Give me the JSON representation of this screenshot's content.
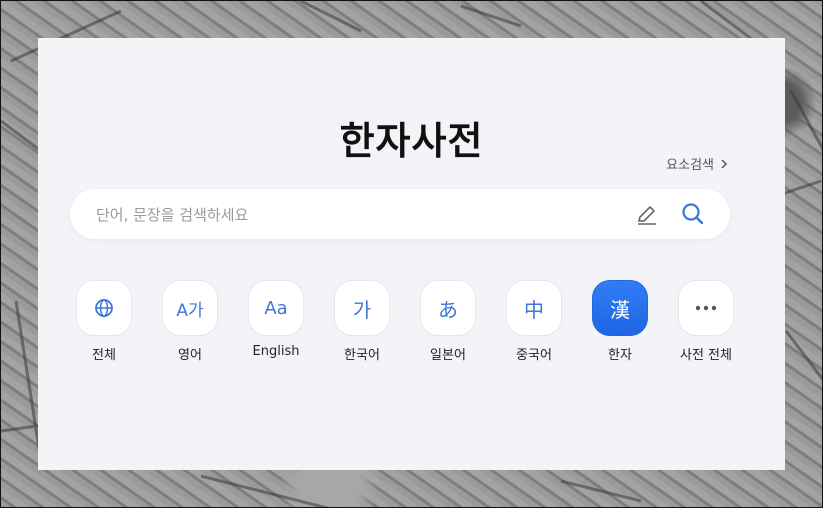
{
  "page": {
    "title": "한자사전",
    "element_search": "요소검색",
    "search": {
      "placeholder": "단어, 문장을 검색하세요",
      "value": ""
    },
    "icons": {
      "pen": "pen-icon",
      "search": "search-icon",
      "chevron": "chevron-right-icon"
    },
    "categories": [
      {
        "label": "전체",
        "glyph": "",
        "icon": "globe-icon"
      },
      {
        "label": "영어",
        "glyph": "A가",
        "icon": ""
      },
      {
        "label": "English",
        "glyph": "Aa",
        "icon": ""
      },
      {
        "label": "한국어",
        "glyph": "가",
        "icon": ""
      },
      {
        "label": "일본어",
        "glyph": "あ",
        "icon": ""
      },
      {
        "label": "중국어",
        "glyph": "中",
        "icon": ""
      },
      {
        "label": "한자",
        "glyph": "漢",
        "icon": "",
        "active": true
      },
      {
        "label": "사전 전체",
        "glyph": "",
        "icon": "more-dots-icon"
      }
    ],
    "colors": {
      "accent": "#2f7df6",
      "icon": "#3f76d8",
      "panel": "#f3f4f8"
    }
  }
}
